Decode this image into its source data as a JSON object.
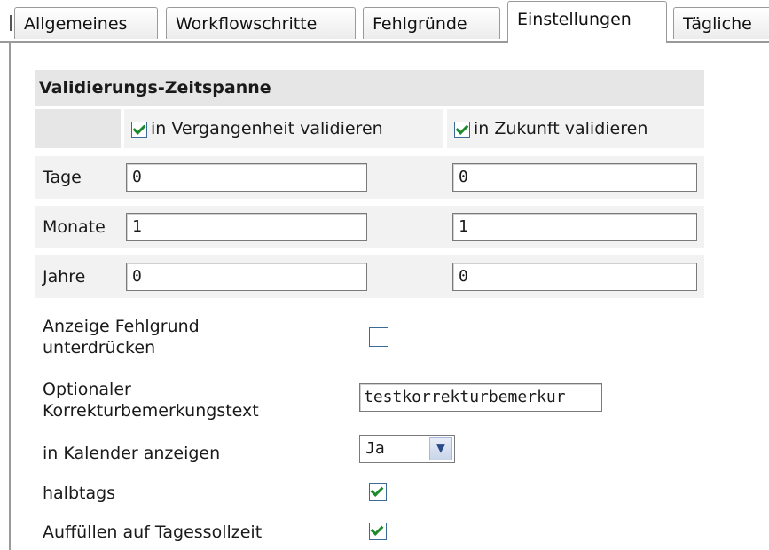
{
  "tabs": [
    {
      "label": "Allgemeines",
      "active": false
    },
    {
      "label": "Workflowschritte",
      "active": false
    },
    {
      "label": "Fehlgründe",
      "active": false
    },
    {
      "label": "Einstellungen",
      "active": true
    },
    {
      "label": "Tägliche",
      "active": false
    }
  ],
  "section": {
    "title": "Validierungs-Zeitspanne",
    "past_label": "in Vergangenheit validieren",
    "past_checked": true,
    "future_label": "in Zukunft validieren",
    "future_checked": true
  },
  "rows": [
    {
      "label": "Tage",
      "past": "0",
      "future": "0"
    },
    {
      "label": "Monate",
      "past": "1",
      "future": "1"
    },
    {
      "label": "Jahre",
      "past": "0",
      "future": "0"
    }
  ],
  "options": {
    "suppress_label_1": "Anzeige Fehlgrund",
    "suppress_label_2": "unterdrücken",
    "suppress_checked": false,
    "remark_label_1": "Optionaler",
    "remark_label_2": "Korrekturbemerkungstext",
    "remark_value": "testkorrekturbemerkur",
    "calendar_label": "in Kalender anzeigen",
    "calendar_value": "Ja",
    "halfday_label": "halbtags",
    "halfday_checked": true,
    "fill_label": "Auffüllen auf Tagessollzeit",
    "fill_checked": true
  },
  "colors": {
    "section_bg": "#e6e6e6",
    "row_bg": "#f2f2f2",
    "check": "#1a8a2a"
  }
}
